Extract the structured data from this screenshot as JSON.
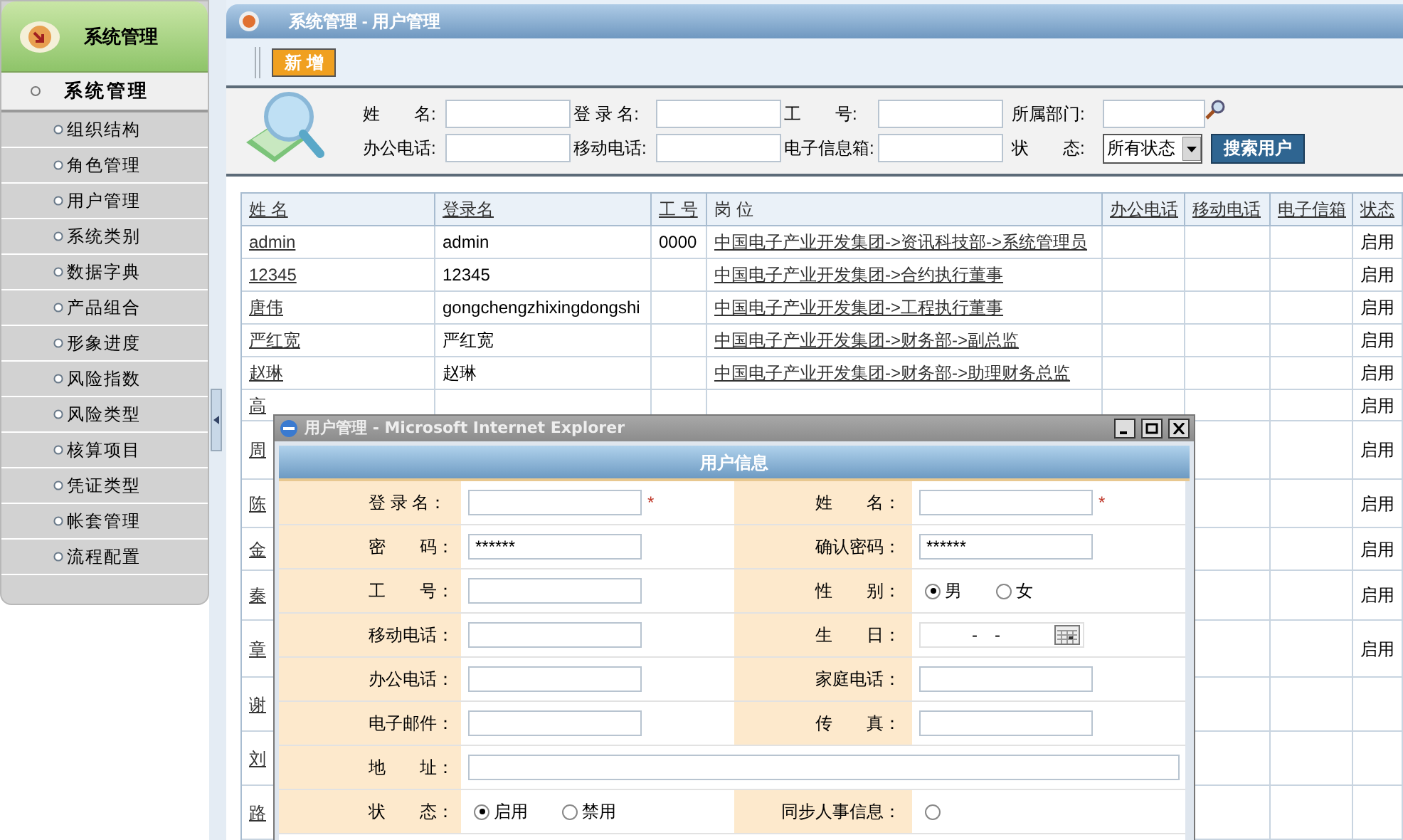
{
  "sidebar": {
    "title": "系统管理",
    "section": {
      "label": "系统管理",
      "expanded": true
    },
    "items": [
      {
        "label": "组织结构",
        "selected": false
      },
      {
        "label": "角色管理",
        "selected": false
      },
      {
        "label": "用户管理",
        "selected": false
      },
      {
        "label": "系统类别",
        "selected": false
      },
      {
        "label": "数据字典",
        "selected": false
      },
      {
        "label": "产品组合",
        "selected": false
      },
      {
        "label": "形象进度",
        "selected": false
      },
      {
        "label": "风险指数",
        "selected": false
      },
      {
        "label": "风险类型",
        "selected": false
      },
      {
        "label": "核算项目",
        "selected": false
      },
      {
        "label": "凭证类型",
        "selected": false
      },
      {
        "label": "帐套管理",
        "selected": false
      },
      {
        "label": "流程配置",
        "selected": false
      }
    ]
  },
  "page": {
    "title": "系统管理 - 用户管理"
  },
  "toolbar": {
    "buttons": [
      "新 增"
    ]
  },
  "search": {
    "rows": [
      [
        {
          "label": "姓　　名:",
          "kind": "text"
        },
        {
          "label": "登 录 名:",
          "kind": "text"
        },
        {
          "label": "工　　号:",
          "kind": "text"
        },
        {
          "label": "所属部门:",
          "kind": "lookup"
        }
      ],
      [
        {
          "label": "办公电话:",
          "kind": "text"
        },
        {
          "label": "移动电话:",
          "kind": "text"
        },
        {
          "label": "电子信息箱:",
          "kind": "text"
        },
        {
          "label": "状　　态:",
          "kind": "select",
          "value": "所有状态"
        }
      ]
    ],
    "button": "搜索用户"
  },
  "table": {
    "columns": [
      {
        "label": "姓 名",
        "sortable": true
      },
      {
        "label": "登录名",
        "sortable": true
      },
      {
        "label": "工 号",
        "sortable": true
      },
      {
        "label": "岗 位",
        "sortable": false
      },
      {
        "label": "办公电话",
        "sortable": true
      },
      {
        "label": "移动电话",
        "sortable": true
      },
      {
        "label": "电子信箱",
        "sortable": true
      },
      {
        "label": "状态",
        "sortable": true
      }
    ],
    "rows": [
      {
        "name": "admin",
        "login": "admin",
        "number": "0000",
        "position": "中国电子产业开发集团->资讯科技部->系统管理员",
        "status": "启用"
      },
      {
        "name": "12345",
        "login": "12345",
        "position": "中国电子产业开发集团->合约执行董事",
        "status": "启用"
      },
      {
        "name": "唐伟",
        "login": "gongchengzhixingdongshi",
        "position": "中国电子产业开发集团->工程执行董事",
        "status": "启用"
      },
      {
        "name": "严红宽",
        "login": "严红宽",
        "position": "中国电子产业开发集团->财务部->副总监",
        "status": "启用"
      },
      {
        "name": "赵琳",
        "login": "赵琳",
        "position": "中国电子产业开发集团->财务部->助理财务总监",
        "status": "启用"
      },
      {
        "name": "高",
        "status": "启用"
      },
      {
        "name": "周",
        "status": "启用"
      },
      {
        "name": "陈",
        "status": "启用"
      },
      {
        "name": "金",
        "status": "启用"
      },
      {
        "name": "秦",
        "status": "启用"
      },
      {
        "name": "章",
        "status": "启用"
      },
      {
        "name": "谢"
      },
      {
        "name": "刘"
      },
      {
        "name": "路"
      }
    ]
  },
  "dialog": {
    "title": "用户管理 - Microsoft Internet Explorer",
    "header": "用户信息",
    "required_mark": "*",
    "rows": [
      [
        {
          "label": "登 录 名：",
          "kind": "text",
          "required": true
        },
        {
          "label": "姓　　名：",
          "kind": "text",
          "required": true
        }
      ],
      [
        {
          "label": "密　　码：",
          "kind": "text",
          "value": "******",
          "required": false
        },
        {
          "label": "确认密码：",
          "kind": "text",
          "value": "******",
          "required": false
        }
      ],
      [
        {
          "label": "工　　号：",
          "kind": "text",
          "required": false
        },
        {
          "label": "性　　别：",
          "kind": "radio",
          "options": [
            {
              "label": "男",
              "selected": true
            },
            {
              "label": "女",
              "selected": false
            }
          ]
        }
      ],
      [
        {
          "label": "移动电话：",
          "kind": "text",
          "required": false
        },
        {
          "label": "生　　日：",
          "kind": "date",
          "value": "-　-"
        }
      ],
      [
        {
          "label": "办公电话：",
          "kind": "text",
          "required": false
        },
        {
          "label": "家庭电话：",
          "kind": "text",
          "required": false
        }
      ],
      [
        {
          "label": "电子邮件：",
          "kind": "text",
          "required": false
        },
        {
          "label": "传　　真：",
          "kind": "text",
          "required": false
        }
      ],
      [
        {
          "label": "地　　址：",
          "kind": "wide"
        }
      ],
      [
        {
          "label": "状　　态：",
          "kind": "radio",
          "options": [
            {
              "label": "启用",
              "selected": true
            },
            {
              "label": "禁用",
              "selected": false
            }
          ]
        },
        {
          "label": "同步人事信息：",
          "kind": "radio",
          "options": [
            {
              "selected": false
            }
          ]
        }
      ]
    ]
  }
}
